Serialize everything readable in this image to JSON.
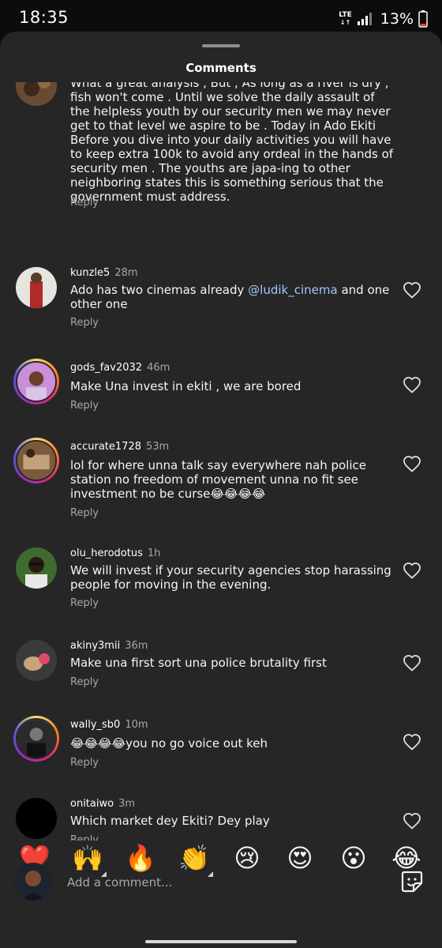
{
  "status_bar": {
    "time": "18:35",
    "network": "LTE",
    "battery": "13%"
  },
  "sheet": {
    "title": "Comments"
  },
  "comments": [
    {
      "username": "",
      "time": "",
      "text": "What a great analysis , But , As long as a river is dry , fish won't come . Until we solve the daily assault of the helpless youth by our security men we may never get to that level we aspire to be . Today in Ado Ekiti Before you dive into your daily activities you will have to keep extra 100k to avoid any ordeal in the hands of security men .  The youths are japa-ing to other neighboring states this is something serious that the government must address.",
      "reply": "Reply"
    },
    {
      "username": "kunzle5",
      "time": "28m",
      "text_before": "Ado has two cinemas already ",
      "mention": "@ludik_cinema",
      "text_after": " and one other one",
      "reply": "Reply"
    },
    {
      "username": "gods_fav2032",
      "time": "46m",
      "text": "Make Una invest in ekiti , we are bored",
      "reply": "Reply"
    },
    {
      "username": "accurate1728",
      "time": "53m",
      "text": "lol for where unna talk say everywhere nah police station no freedom of movement unna no fit see investment no be curse😂😂😂😂",
      "reply": "Reply"
    },
    {
      "username": "olu_herodotus",
      "time": "1h",
      "text": "We will invest if your security agencies stop harassing people for moving in the evening.",
      "reply": "Reply"
    },
    {
      "username": "akiny3mii",
      "time": "36m",
      "text": "Make una first sort una police brutality first",
      "reply": "Reply"
    },
    {
      "username": "wally_sb0",
      "time": "10m",
      "text": "😂😂😂😂you no go voice out keh",
      "reply": "Reply"
    },
    {
      "username": "onitaiwo",
      "time": "3m",
      "text": "Which market dey Ekiti? Dey play",
      "reply": "Reply"
    }
  ],
  "emoji_bar": [
    "❤️",
    "🙌",
    "🔥",
    "👏",
    "😢",
    "😍",
    "😮",
    "😂"
  ],
  "composer": {
    "placeholder": "Add a comment..."
  },
  "colors": {
    "sheet_bg": "#262626",
    "mention": "#9fc8ff",
    "secondary_text": "#a8a8a8"
  }
}
